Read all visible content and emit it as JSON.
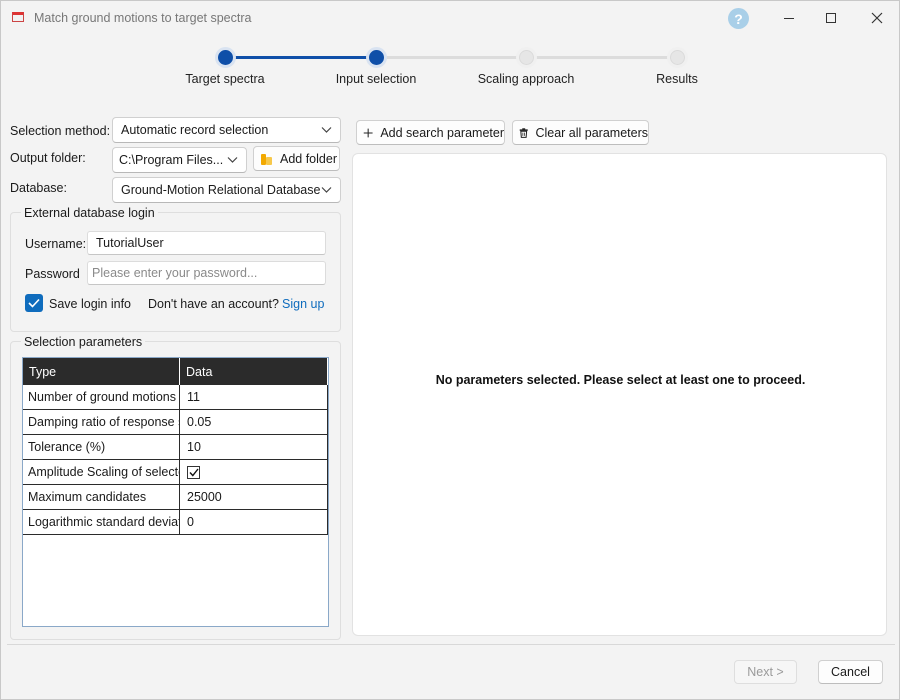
{
  "window": {
    "title": "Match ground motions to target spectra"
  },
  "stepper": {
    "steps": [
      {
        "label": "Target spectra",
        "state": "done"
      },
      {
        "label": "Input selection",
        "state": "current"
      },
      {
        "label": "Scaling approach",
        "state": "todo"
      },
      {
        "label": "Results",
        "state": "todo"
      }
    ]
  },
  "form": {
    "selection_method_label": "Selection method:",
    "selection_method_value": "Automatic record selection",
    "output_folder_label": "Output folder:",
    "output_folder_value": "C:\\Program Files...",
    "add_folder_label": "Add folder",
    "database_label": "Database:",
    "database_value": "Ground-Motion Relational Database"
  },
  "login": {
    "group_title": "External database login",
    "username_label": "Username:",
    "username_value": "TutorialUser",
    "password_label": "Password",
    "password_placeholder": "Please enter your password...",
    "save_login_label": "Save login info",
    "save_login_checked": true,
    "no_account_text": "Don't have an account?",
    "sign_up_label": "Sign up"
  },
  "params": {
    "group_title": "Selection parameters",
    "columns": [
      "Type",
      "Data"
    ],
    "rows": [
      {
        "type": "Number of ground motions",
        "data": "11"
      },
      {
        "type": "Damping ratio of response s",
        "data": "0.05"
      },
      {
        "type": "Tolerance (%)",
        "data": "10"
      },
      {
        "type": "Amplitude Scaling of selecte",
        "data": "",
        "checked": true
      },
      {
        "type": "Maximum candidates",
        "data": "25000"
      },
      {
        "type": "Logarithmic standard deviati",
        "data": "0"
      }
    ]
  },
  "toolbar": {
    "add_search_label": "Add search parameter",
    "clear_all_label": "Clear all parameters"
  },
  "right_panel": {
    "empty_message": "No parameters selected. Please select at least one to proceed."
  },
  "footer": {
    "next_label": "Next >",
    "cancel_label": "Cancel"
  },
  "colors": {
    "accent": "#0f6cbd",
    "stepper_done": "#0f4fa8",
    "table_header": "#2b2b2b"
  }
}
